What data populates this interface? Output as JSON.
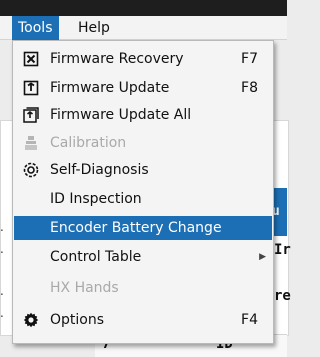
{
  "menubar": {
    "tools": "Tools",
    "help": "Help"
  },
  "background": {
    "header_text": "Nu",
    "partial_texts": [
      "Ir",
      "re"
    ],
    "row_number": "7",
    "row_id": "ID"
  },
  "menu": {
    "items": [
      {
        "label": "Firmware Recovery",
        "shortcut": "F7",
        "icon": "firmware-recovery-icon",
        "enabled": true
      },
      {
        "label": "Firmware Update",
        "shortcut": "F8",
        "icon": "firmware-update-icon",
        "enabled": true
      },
      {
        "label": "Firmware Update All",
        "shortcut": "",
        "icon": "firmware-update-all-icon",
        "enabled": true
      },
      {
        "label": "Calibration",
        "shortcut": "",
        "icon": "calibration-icon",
        "enabled": false
      },
      {
        "label": "Self-Diagnosis",
        "shortcut": "",
        "icon": "self-diagnosis-icon",
        "enabled": true
      },
      {
        "label": "ID Inspection",
        "shortcut": "",
        "icon": "",
        "enabled": true
      },
      {
        "label": "Encoder Battery Change",
        "shortcut": "",
        "icon": "",
        "enabled": true,
        "highlighted": true
      },
      {
        "label": "Control Table",
        "shortcut": "",
        "icon": "",
        "enabled": true,
        "submenu": true
      },
      {
        "label": "HX Hands",
        "shortcut": "",
        "icon": "",
        "enabled": false
      },
      {
        "label": "Options",
        "shortcut": "F4",
        "icon": "gear-icon",
        "enabled": true
      }
    ]
  },
  "colors": {
    "highlight": "#1d6fb5",
    "disabled_text": "#a9a9a9"
  }
}
